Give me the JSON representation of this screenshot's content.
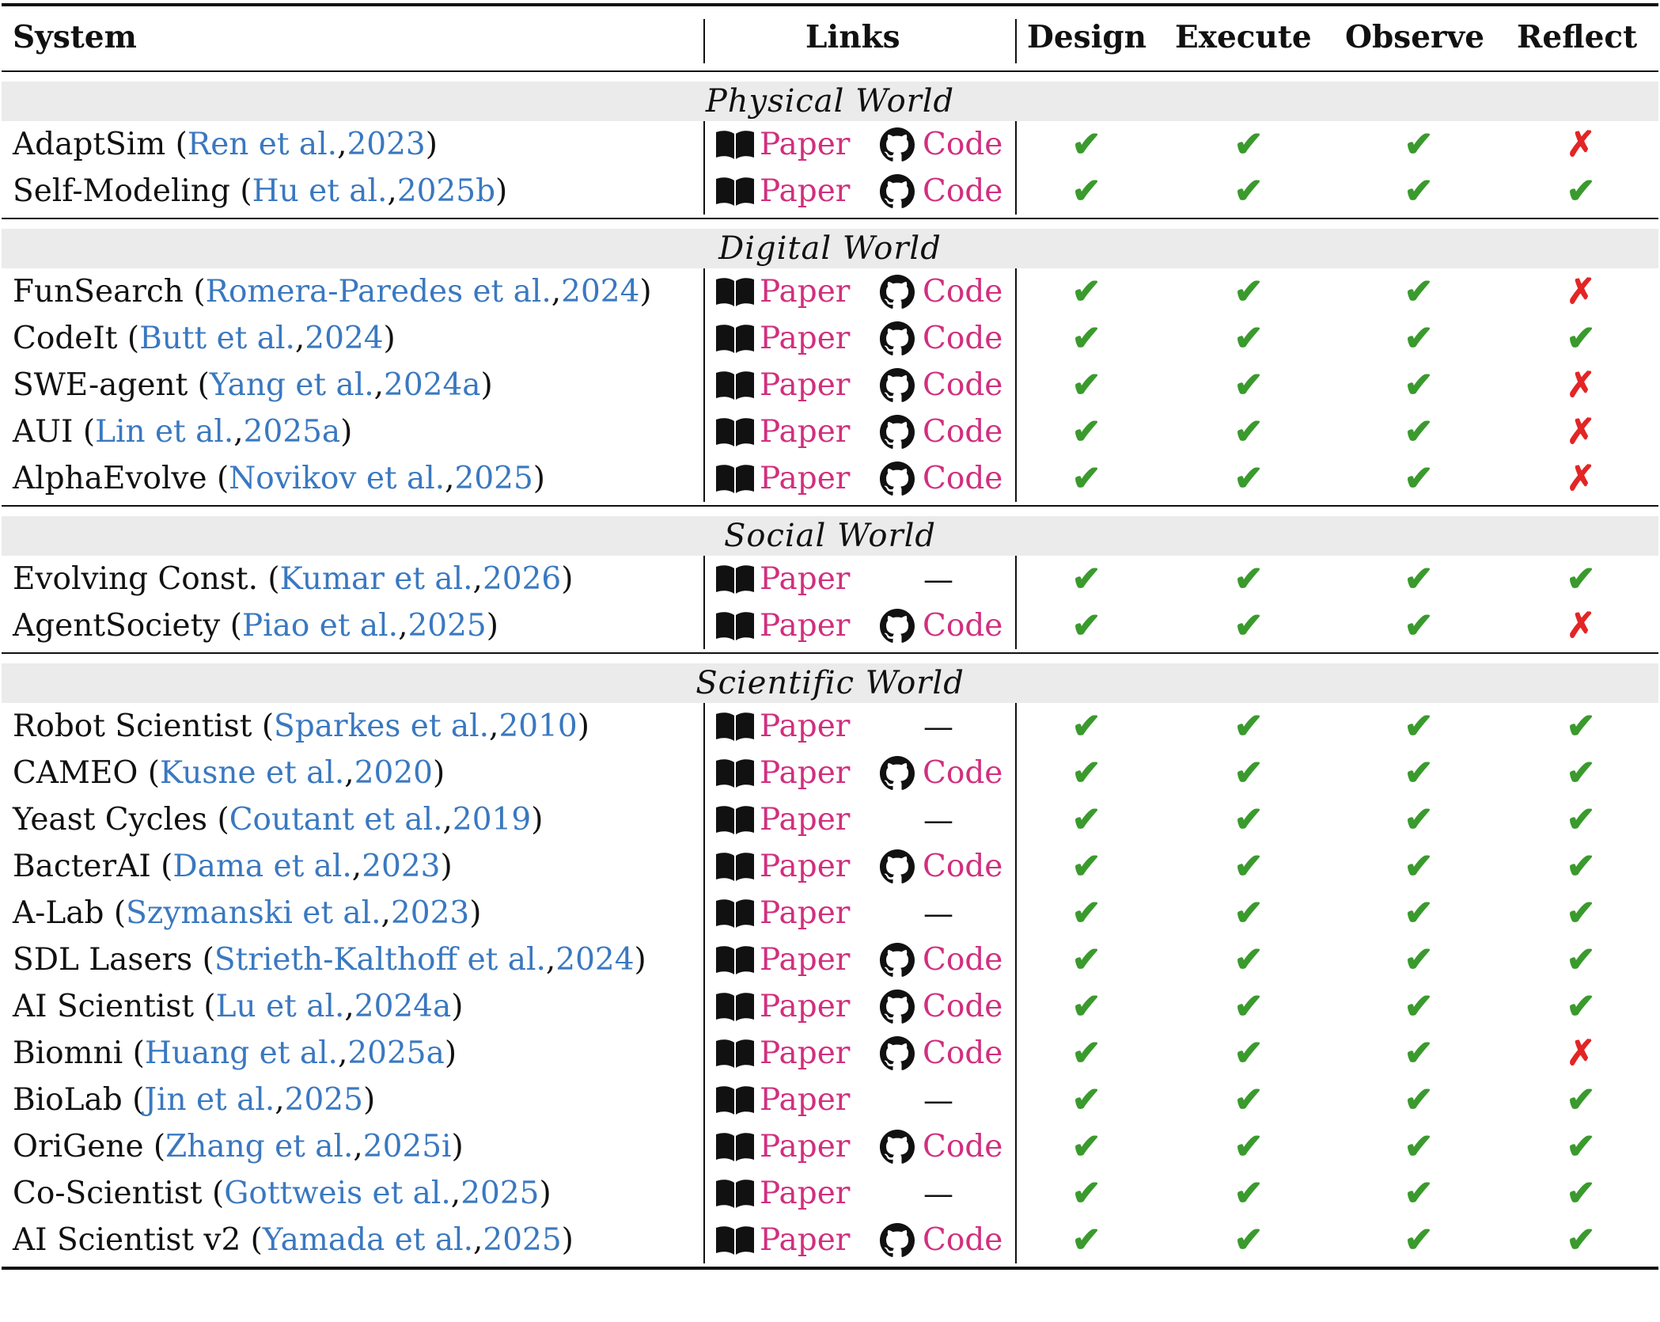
{
  "header": {
    "system": "System",
    "links": "Links",
    "design": "Design",
    "execute": "Execute",
    "observe": "Observe",
    "reflect": "Reflect"
  },
  "labels": {
    "paper": "Paper",
    "code": "Code",
    "none": "—"
  },
  "colors": {
    "check": "#3a9a2d",
    "cross": "#e32525",
    "link": "#d12f7e",
    "citation": "#3a78c0",
    "section_bg": "#ebebeb"
  },
  "icons": {
    "paper": "book-icon",
    "code": "github-icon"
  },
  "sections": [
    {
      "title": "Physical World",
      "rows": [
        {
          "name": "AdaptSim",
          "authors": "Ren et al.",
          "year": "2023",
          "code": true,
          "design": true,
          "execute": true,
          "observe": true,
          "reflect": false
        },
        {
          "name": "Self-Modeling",
          "authors": "Hu et al.",
          "year": "2025b",
          "code": true,
          "design": true,
          "execute": true,
          "observe": true,
          "reflect": true
        }
      ]
    },
    {
      "title": "Digital World",
      "rows": [
        {
          "name": "FunSearch",
          "authors": "Romera-Paredes et al.",
          "year": "2024",
          "code": true,
          "design": true,
          "execute": true,
          "observe": true,
          "reflect": false
        },
        {
          "name": "CodeIt",
          "authors": "Butt et al.",
          "year": "2024",
          "code": true,
          "design": true,
          "execute": true,
          "observe": true,
          "reflect": true
        },
        {
          "name": "SWE-agent",
          "authors": "Yang et al.",
          "year": "2024a",
          "code": true,
          "design": true,
          "execute": true,
          "observe": true,
          "reflect": false
        },
        {
          "name": "AUI",
          "authors": "Lin et al.",
          "year": "2025a",
          "code": true,
          "design": true,
          "execute": true,
          "observe": true,
          "reflect": false
        },
        {
          "name": "AlphaEvolve",
          "authors": "Novikov et al.",
          "year": "2025",
          "code": true,
          "design": true,
          "execute": true,
          "observe": true,
          "reflect": false
        }
      ]
    },
    {
      "title": "Social World",
      "rows": [
        {
          "name": "Evolving Const.",
          "authors": "Kumar et al.",
          "year": "2026",
          "code": false,
          "design": true,
          "execute": true,
          "observe": true,
          "reflect": true
        },
        {
          "name": "AgentSociety",
          "authors": "Piao et al.",
          "year": "2025",
          "code": true,
          "design": true,
          "execute": true,
          "observe": true,
          "reflect": false
        }
      ]
    },
    {
      "title": "Scientific World",
      "rows": [
        {
          "name": "Robot Scientist",
          "authors": "Sparkes et al.",
          "year": "2010",
          "code": false,
          "design": true,
          "execute": true,
          "observe": true,
          "reflect": true
        },
        {
          "name": "CAMEO",
          "authors": "Kusne et al.",
          "year": "2020",
          "code": true,
          "design": true,
          "execute": true,
          "observe": true,
          "reflect": true
        },
        {
          "name": "Yeast Cycles",
          "authors": "Coutant et al.",
          "year": "2019",
          "code": false,
          "design": true,
          "execute": true,
          "observe": true,
          "reflect": true
        },
        {
          "name": "BacterAI",
          "authors": "Dama et al.",
          "year": "2023",
          "code": true,
          "design": true,
          "execute": true,
          "observe": true,
          "reflect": true
        },
        {
          "name": "A-Lab",
          "authors": "Szymanski et al.",
          "year": "2023",
          "code": false,
          "design": true,
          "execute": true,
          "observe": true,
          "reflect": true
        },
        {
          "name": "SDL Lasers",
          "authors": "Strieth-Kalthoff et al.",
          "year": "2024",
          "code": true,
          "design": true,
          "execute": true,
          "observe": true,
          "reflect": true
        },
        {
          "name": "AI Scientist",
          "authors": "Lu et al.",
          "year": "2024a",
          "code": true,
          "design": true,
          "execute": true,
          "observe": true,
          "reflect": true
        },
        {
          "name": "Biomni",
          "authors": "Huang et al.",
          "year": "2025a",
          "code": true,
          "design": true,
          "execute": true,
          "observe": true,
          "reflect": false
        },
        {
          "name": "BioLab",
          "authors": "Jin et al.",
          "year": "2025",
          "code": false,
          "design": true,
          "execute": true,
          "observe": true,
          "reflect": true
        },
        {
          "name": "OriGene",
          "authors": "Zhang et al.",
          "year": "2025i",
          "code": true,
          "design": true,
          "execute": true,
          "observe": true,
          "reflect": true
        },
        {
          "name": "Co-Scientist",
          "authors": "Gottweis et al.",
          "year": "2025",
          "code": false,
          "design": true,
          "execute": true,
          "observe": true,
          "reflect": true
        },
        {
          "name": "AI Scientist v2",
          "authors": "Yamada et al.",
          "year": "2025",
          "code": true,
          "design": true,
          "execute": true,
          "observe": true,
          "reflect": true
        }
      ]
    }
  ]
}
